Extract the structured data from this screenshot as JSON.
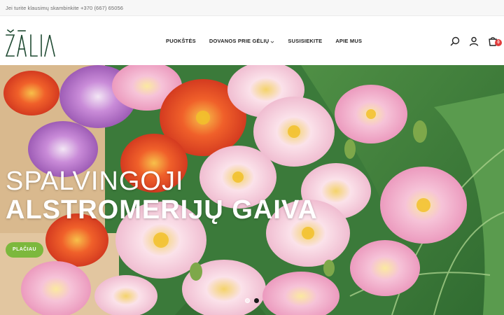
{
  "topbar": {
    "text": "Jei turite klausimų skambinkite +370 (667) 65056"
  },
  "logo": {
    "text": "ŽĀLIA"
  },
  "nav": {
    "items": [
      {
        "label": "PUOKŠTĖS"
      },
      {
        "label": "DOVANOS PRIE GĖLIŲ",
        "has_dropdown": true
      },
      {
        "label": "SUSISIEKITE"
      },
      {
        "label": "APIE MUS"
      }
    ]
  },
  "header_icons": {
    "search": "search-icon",
    "account": "user-icon",
    "cart": "cart-icon",
    "cart_count": "0"
  },
  "hero": {
    "title_line1": "SPALVINGOJI",
    "title_line2": "ALSTROMERIJŲ GAIVA",
    "button_label": "PLAČIAU",
    "slides": 2,
    "active_slide": 2
  },
  "colors": {
    "accent": "#7cb83d",
    "badge": "#e13d3d",
    "text": "#222222"
  }
}
